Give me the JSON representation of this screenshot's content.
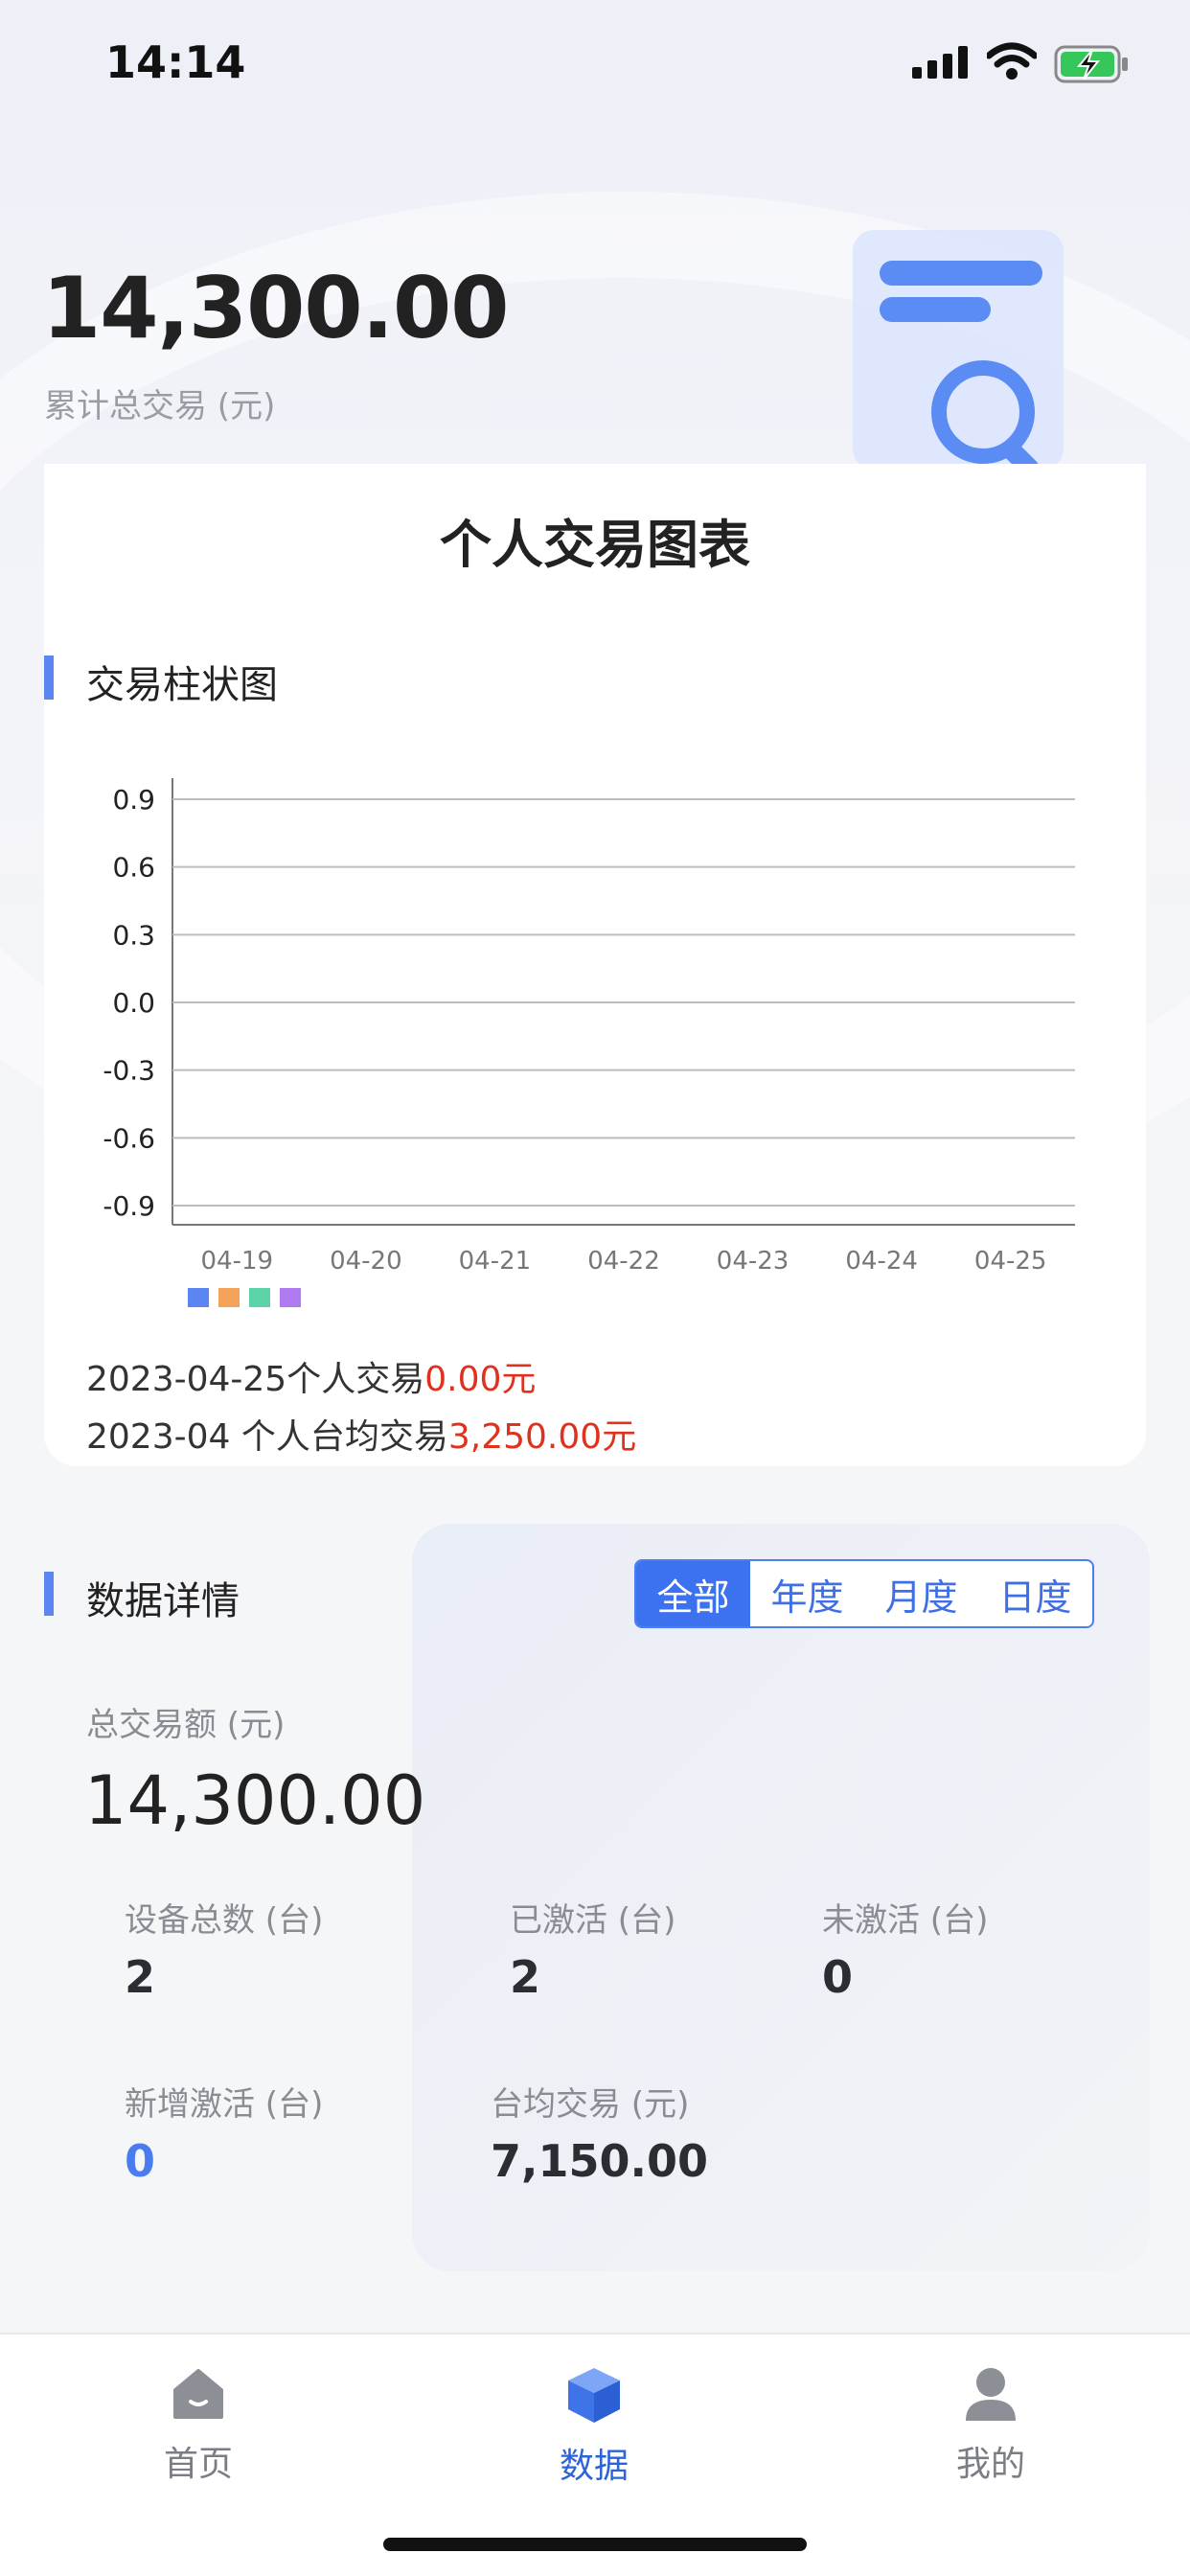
{
  "status_bar": {
    "time": "14:14"
  },
  "header": {
    "total_amount": "14,300.00",
    "total_label": "累计总交易 (元)"
  },
  "chart_card": {
    "title": "个人交易图表",
    "section_title": "交易柱状图",
    "footnote_1": {
      "prefix": "2023-04-25个人交易",
      "amount": "0.00",
      "unit": "元"
    },
    "footnote_2": {
      "prefix": "2023-04 个人台均交易",
      "amount": "3,250.00",
      "unit": "元"
    }
  },
  "chart_data": {
    "type": "bar",
    "categories": [
      "04-19",
      "04-20",
      "04-21",
      "04-22",
      "04-23",
      "04-24",
      "04-25"
    ],
    "series": [
      {
        "values": [
          0,
          0,
          0,
          0,
          0,
          0,
          0
        ],
        "color": "#5b86f1"
      },
      {
        "values": [
          0,
          0,
          0,
          0,
          0,
          0,
          0
        ],
        "color": "#f4a35a"
      },
      {
        "values": [
          0,
          0,
          0,
          0,
          0,
          0,
          0
        ],
        "color": "#5bd3a6"
      },
      {
        "values": [
          0,
          0,
          0,
          0,
          0,
          0,
          0
        ],
        "color": "#b07af0"
      }
    ],
    "yticks": [
      "0.9",
      "0.6",
      "0.3",
      "0.0",
      "-0.3",
      "-0.6",
      "-0.9"
    ],
    "ylim": [
      -0.9,
      0.9
    ],
    "grid": true,
    "legend": "bottom-left"
  },
  "details": {
    "section_title": "数据详情",
    "filters": [
      "全部",
      "年度",
      "月度",
      "日度"
    ],
    "active_filter": "全部",
    "total_label": "总交易额 (元)",
    "total_value": "14,300.00",
    "stats": [
      {
        "label": "设备总数 (台)",
        "value": "2"
      },
      {
        "label": "已激活 (台)",
        "value": "2"
      },
      {
        "label": "未激活 (台)",
        "value": "0"
      },
      {
        "label": "新增激活 (台)",
        "value": "0"
      },
      {
        "label": "台均交易 (元)",
        "value": "7,150.00"
      }
    ]
  },
  "tabbar": {
    "items": [
      {
        "label": "首页",
        "icon": "home-icon"
      },
      {
        "label": "数据",
        "icon": "cube-icon"
      },
      {
        "label": "我的",
        "icon": "user-icon"
      }
    ],
    "active": "数据"
  },
  "colors": {
    "accent": "#3c72f0",
    "highlight": "#e0311f"
  }
}
